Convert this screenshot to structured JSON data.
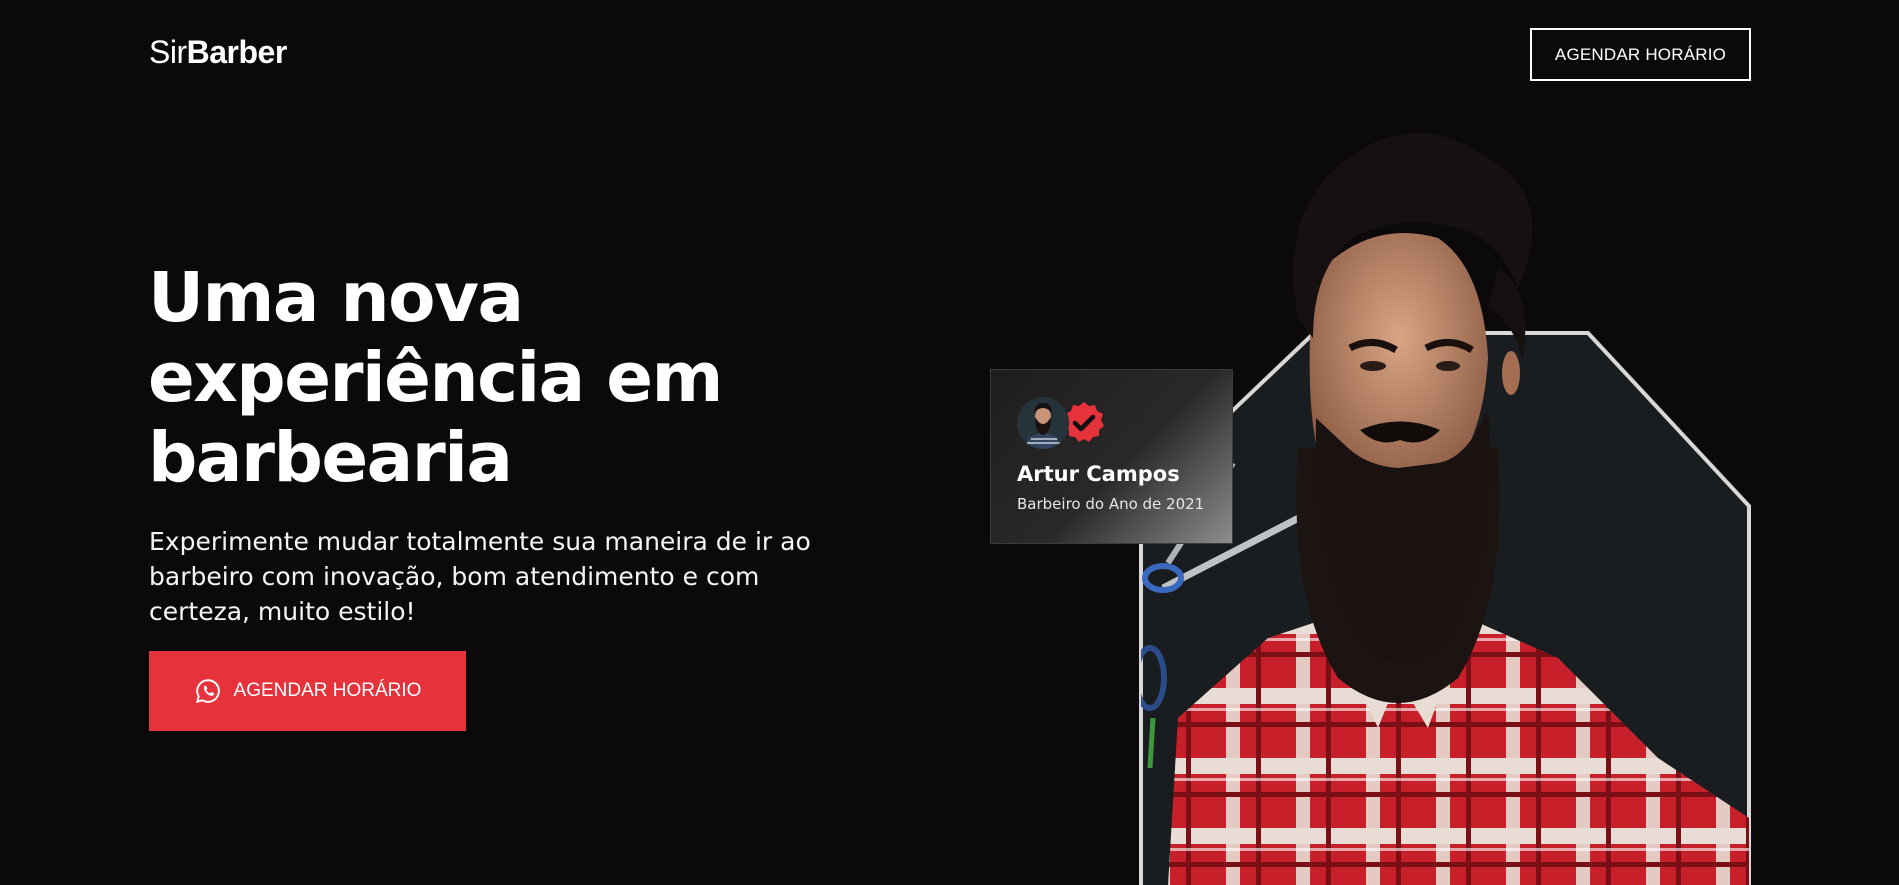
{
  "brand": {
    "logo_light": "Sir",
    "logo_bold": "Barber"
  },
  "header": {
    "cta_label": "AGENDAR HORÁRIO"
  },
  "hero": {
    "title": "Uma nova experiência em barbearia",
    "subtitle": "Experimente mudar totalmente sua maneira de ir ao barbeiro com inovação, bom atendimento e com certeza, muito estilo!",
    "cta_label": "AGENDAR HORÁRIO",
    "cta_icon": "whatsapp-icon"
  },
  "barber_card": {
    "name": "Artur Campos",
    "title": "Barbeiro do Ano de 2021",
    "badge_icon": "verified-check-icon"
  },
  "colors": {
    "background": "#0c090a",
    "accent": "#e5323b",
    "text": "#ffffff"
  }
}
